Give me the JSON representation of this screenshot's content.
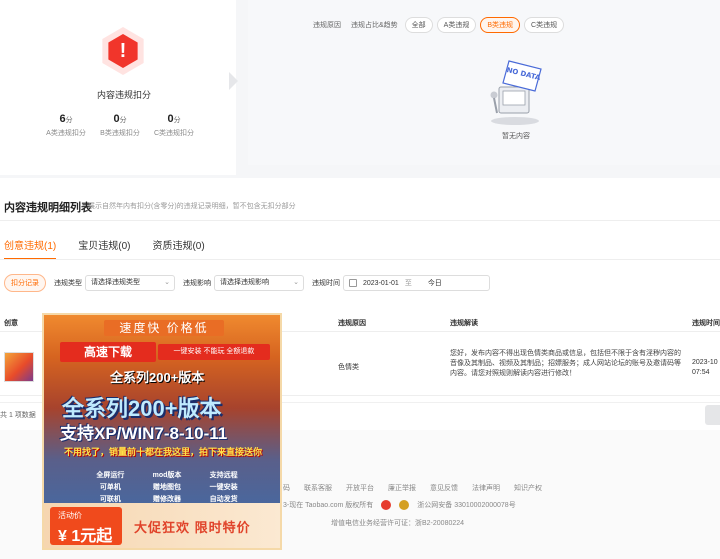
{
  "summary": {
    "title": "内容违规扣分",
    "stats": [
      {
        "value": "6",
        "unit": "分",
        "label": "A类违规扣分"
      },
      {
        "value": "0",
        "unit": "分",
        "label": "B类违规扣分"
      },
      {
        "value": "0",
        "unit": "分",
        "label": "C类违规扣分"
      }
    ]
  },
  "filter_bar": {
    "labels": [
      "违规原因",
      "违规占比&趋势"
    ],
    "chips": [
      "全部",
      "A类违规",
      "B类违规",
      "C类违规"
    ],
    "active_chip": "B类违规"
  },
  "empty_state": {
    "image_text": "NO DATA",
    "text": "暂无内容"
  },
  "detail": {
    "title": "内容违规明细列表",
    "subtitle": "展示自然年内有扣分(含零分)的违规记录明细，暂不包含无扣分部分"
  },
  "tabs": [
    {
      "label": "创意违规(1)",
      "active": true
    },
    {
      "label": "宝贝违规(0)",
      "active": false
    },
    {
      "label": "资质违规(0)",
      "active": false
    }
  ],
  "query": {
    "deduct_button": "扣分记录",
    "type_label": "违规类型",
    "type_placeholder": "请选择违规类型",
    "impact_label": "违规影响",
    "impact_placeholder": "请选择违规影响",
    "time_label": "违规时间",
    "date_start": "2023-01-01",
    "date_sep": "至",
    "date_end": "今日"
  },
  "table": {
    "headers": [
      "创意",
      "违规原因",
      "违规解读",
      "违规时间"
    ],
    "rows": [
      {
        "reason": "色情类",
        "interpretation": "您好，发布内容不得出现色情类商品或信息，包括但不限于含有淫秽内容的音像及其制品、视频及其制品；招嫖服务；成人网站论坛的账号及邀请码等内容。请您对照规则解读内容进行修改！",
        "time_date": "2023-10",
        "time_clock": "07:54"
      }
    ],
    "total": "共 1 项数据"
  },
  "footer": {
    "links": [
      "码",
      "联系客服",
      "开放平台",
      "廉正举报",
      "意见反馈",
      "法律声明",
      "知识产权"
    ],
    "copyright": "3-现在 Taobao.com 版权所有",
    "police": "浙公网安备 33010002000078号",
    "license": "增值电信业务经营许可证：浙B2-20080224"
  },
  "ad": {
    "title": "速度快 价格低",
    "download": "高速下载",
    "tags": "一键安装 不能玩 全额退款",
    "series_small": "全系列200+版本",
    "series_big": "全系列200+版本",
    "os": "支持XP/WIN7-8-10-11",
    "slogan": "不用找了，销量前十都在我这里，拍下来直接送你",
    "features": [
      "全屏运行",
      "mod版本",
      "支持远程",
      "可单机",
      "赠地图包",
      "一键安装",
      "可联机",
      "赠修改器",
      "自动发货"
    ],
    "price_label": "活动价",
    "price": "¥ 1元起",
    "promo": "大促狂欢 限时特价"
  },
  "colors": {
    "accent": "#ff6a00",
    "warning": "#f1352b"
  }
}
